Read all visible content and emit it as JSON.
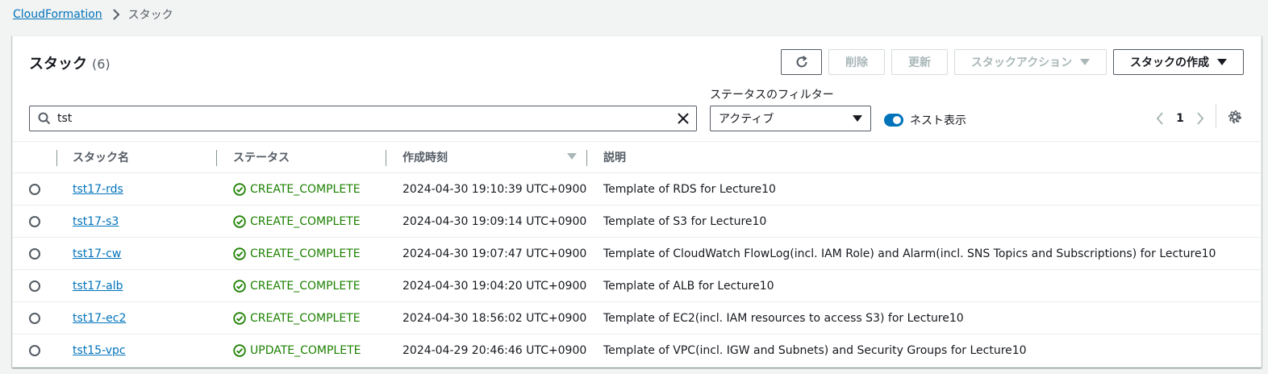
{
  "breadcrumb": {
    "root": "CloudFormation",
    "current": "スタック"
  },
  "panel": {
    "title": "スタック",
    "count": "(6)"
  },
  "toolbar": {
    "refresh_icon": "refresh-icon",
    "delete_label": "削除",
    "update_label": "更新",
    "stack_actions_label": "スタックアクション",
    "create_stack_label": "スタックの作成"
  },
  "filter": {
    "label": "ステータスのフィルター",
    "selected": "アクティブ",
    "nested_label": "ネスト表示",
    "nested_on": true
  },
  "search": {
    "value": "tst",
    "placeholder": ""
  },
  "pagination": {
    "page": "1"
  },
  "table": {
    "columns": [
      "スタック名",
      "ステータス",
      "作成時刻",
      "説明"
    ],
    "rows": [
      {
        "name": "tst17-rds",
        "status": "CREATE_COMPLETE",
        "created": "2024-04-30 19:10:39 UTC+0900",
        "description": "Template of RDS for Lecture10"
      },
      {
        "name": "tst17-s3",
        "status": "CREATE_COMPLETE",
        "created": "2024-04-30 19:09:14 UTC+0900",
        "description": "Template of S3 for Lecture10"
      },
      {
        "name": "tst17-cw",
        "status": "CREATE_COMPLETE",
        "created": "2024-04-30 19:07:47 UTC+0900",
        "description": "Template of CloudWatch FlowLog(incl. IAM Role) and Alarm(incl. SNS Topics and Subscriptions) for Lecture10"
      },
      {
        "name": "tst17-alb",
        "status": "CREATE_COMPLETE",
        "created": "2024-04-30 19:04:20 UTC+0900",
        "description": "Template of ALB for Lecture10"
      },
      {
        "name": "tst17-ec2",
        "status": "CREATE_COMPLETE",
        "created": "2024-04-30 18:56:02 UTC+0900",
        "description": "Template of EC2(incl. IAM resources to access S3) for Lecture10"
      },
      {
        "name": "tst15-vpc",
        "status": "UPDATE_COMPLETE",
        "created": "2024-04-29 20:46:46 UTC+0900",
        "description": "Template of VPC(incl. IGW and Subnets) and Security Groups for Lecture10"
      }
    ]
  },
  "colors": {
    "link": "#0073bb",
    "success": "#1d8102",
    "toggle_on": "#0073bb"
  }
}
